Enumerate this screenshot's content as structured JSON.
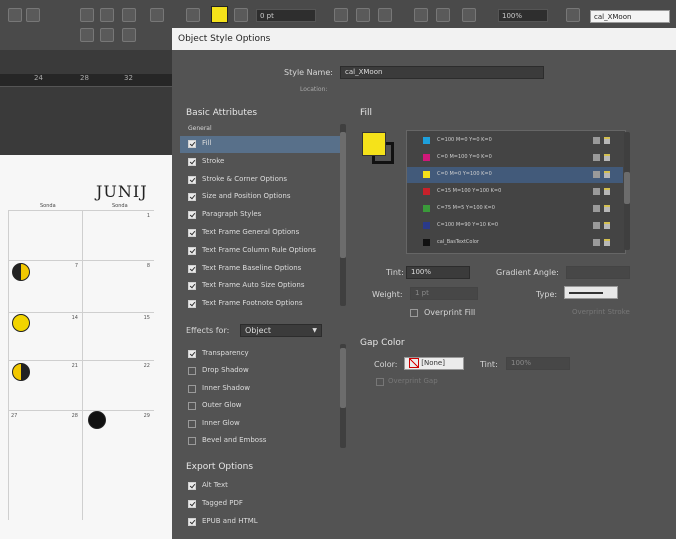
{
  "toolbar": {
    "stroke_weight": "0 pt",
    "percent": "100%",
    "style_field": "cal_XMoon"
  },
  "ruler": {
    "numbers": [
      "24",
      "28",
      "32"
    ]
  },
  "calendar": {
    "title": "Junij",
    "days": [
      "Sonda",
      "Sonda"
    ],
    "numbers": [
      "1",
      "7",
      "8",
      "14",
      "15",
      "21",
      "22",
      "27",
      "28",
      "29"
    ],
    "moon_phases": [
      "first-quarter",
      "full",
      "last-quarter",
      "new"
    ]
  },
  "dialog": {
    "title": "Object Style Options",
    "style_name_label": "Style Name:",
    "style_name_value": "cal_XMoon",
    "location_label": "Location:",
    "basic_attributes_header": "Basic Attributes",
    "general_label": "General",
    "attributes": [
      {
        "label": "Fill",
        "checked": true,
        "selected": true
      },
      {
        "label": "Stroke",
        "checked": true
      },
      {
        "label": "Stroke & Corner Options",
        "checked": true
      },
      {
        "label": "Size and Position Options",
        "checked": true
      },
      {
        "label": "Paragraph Styles",
        "checked": true
      },
      {
        "label": "Text Frame General Options",
        "checked": true
      },
      {
        "label": "Text Frame Column Rule Options",
        "checked": true
      },
      {
        "label": "Text Frame Baseline Options",
        "checked": true
      },
      {
        "label": "Text Frame Auto Size Options",
        "checked": true
      },
      {
        "label": "Text Frame Footnote Options",
        "checked": true
      }
    ],
    "effects_for_label": "Effects for:",
    "effects_for_value": "Object",
    "effects": [
      {
        "label": "Transparency",
        "checked": true
      },
      {
        "label": "Drop Shadow",
        "checked": false
      },
      {
        "label": "Inner Shadow",
        "checked": false
      },
      {
        "label": "Outer Glow",
        "checked": false
      },
      {
        "label": "Inner Glow",
        "checked": false
      },
      {
        "label": "Bevel and Emboss",
        "checked": false
      }
    ],
    "export_header": "Export Options",
    "export_options": [
      {
        "label": "Alt Text",
        "checked": true
      },
      {
        "label": "Tagged PDF",
        "checked": true
      },
      {
        "label": "EPUB and HTML",
        "checked": true
      }
    ],
    "fill_header": "Fill",
    "swatches": [
      {
        "name": "C=100 M=0 Y=0 K=0",
        "color": "#1ea0dc"
      },
      {
        "name": "C=0 M=100 Y=0 K=0",
        "color": "#d0187a"
      },
      {
        "name": "C=0 M=0 Y=100 K=0",
        "color": "#f5e21a",
        "selected": true
      },
      {
        "name": "C=15 M=100 Y=100 K=0",
        "color": "#c8202a"
      },
      {
        "name": "C=75 M=5 Y=100 K=0",
        "color": "#3a9a3a"
      },
      {
        "name": "C=100 M=90 Y=10 K=0",
        "color": "#2a3a8a"
      },
      {
        "name": "cal_BasTextColor",
        "color": "#111111"
      }
    ],
    "tint_label": "Tint:",
    "tint_value": "100%",
    "gradient_angle_label": "Gradient Angle:",
    "weight_label": "Weight:",
    "weight_value": "1 pt",
    "type_label": "Type:",
    "overprint_fill_label": "Overprint Fill",
    "overprint_stroke_label": "Overprint Stroke",
    "gap_color_header": "Gap Color",
    "color_label": "Color:",
    "color_value": "[None]",
    "gap_tint_label": "Tint:",
    "gap_tint_value": "100%",
    "overprint_gap_label": "Overprint Gap"
  }
}
